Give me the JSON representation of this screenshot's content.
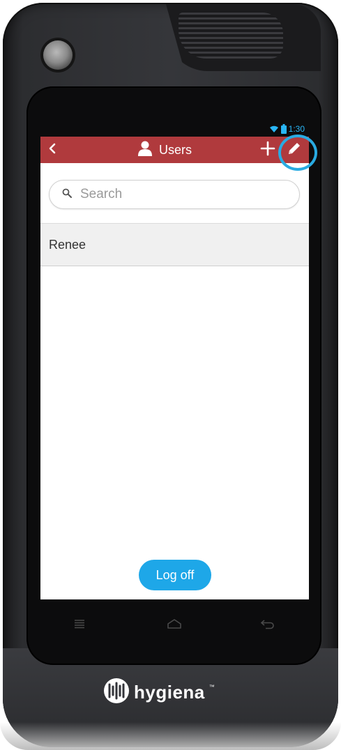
{
  "status_bar": {
    "time": "1:30",
    "icons": [
      "wifi-icon",
      "battery-icon"
    ],
    "accent_color": "#29b6f6"
  },
  "header": {
    "title": "Users",
    "title_icon": "user-icon",
    "back_icon": "chevron-left-icon",
    "add_icon": "plus-icon",
    "edit_icon": "pencil-icon",
    "background_color": "#b03a3d"
  },
  "search": {
    "placeholder": "Search",
    "value": "",
    "icon": "search-icon"
  },
  "users": {
    "items": [
      {
        "name": "Renee"
      }
    ]
  },
  "footer": {
    "logoff_label": "Log off",
    "button_color": "#1ea7e8"
  },
  "navigation": {
    "icons": [
      "menu-icon",
      "home-icon",
      "back-arrow-icon"
    ]
  },
  "device": {
    "brand": "hygiena",
    "trademark": "™",
    "highlight_color": "#29abe2"
  }
}
